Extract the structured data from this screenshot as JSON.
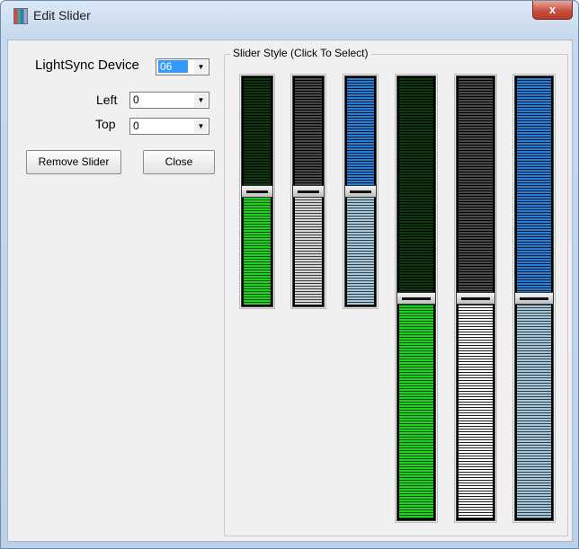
{
  "window": {
    "title": "Edit Slider",
    "close_glyph": "x"
  },
  "form": {
    "device_label": "LightSync Device",
    "device_value": "06",
    "left_label": "Left",
    "left_value": "0",
    "top_label": "Top",
    "top_value": "0",
    "remove_label": "Remove Slider",
    "close_label": "Close"
  },
  "slider_group": {
    "label": "Slider Style (Click To Select)",
    "styles": [
      {
        "name": "green-small",
        "color": "#1fd21f",
        "level": 0.5
      },
      {
        "name": "gray-small",
        "color": "#d5d5d5",
        "level": 0.5
      },
      {
        "name": "blue-small",
        "color": "#2a7fd4",
        "level": 0.5
      },
      {
        "name": "green-large",
        "color": "#1fd21f",
        "level": 0.5
      },
      {
        "name": "white-large",
        "color": "#ffffff",
        "level": 0.5
      },
      {
        "name": "blue-large",
        "color": "#2a7fd4",
        "level": 0.5
      }
    ]
  },
  "icons": {
    "app": "app-icon",
    "dropdown": "chevron-down-icon"
  }
}
